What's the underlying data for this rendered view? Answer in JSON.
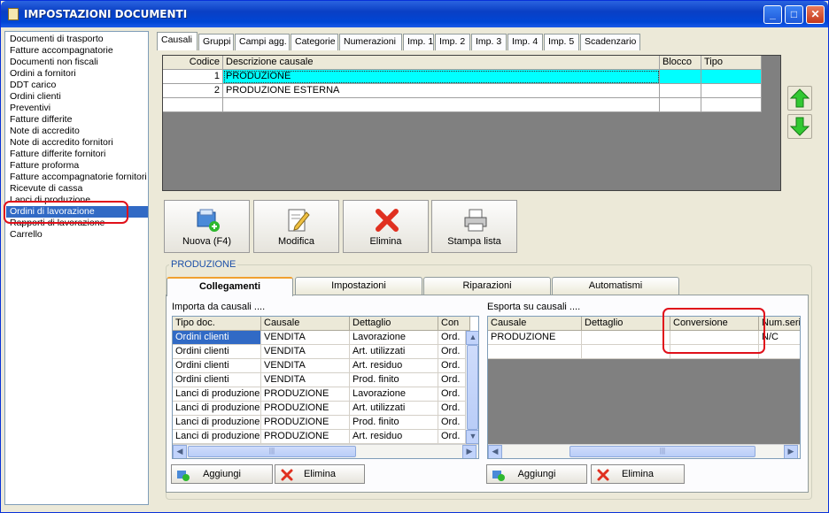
{
  "window": {
    "title": "IMPOSTAZIONI DOCUMENTI"
  },
  "left_list": {
    "items": [
      "Documenti di trasporto",
      "Fatture accompagnatorie",
      "Documenti non fiscali",
      "Ordini a fornitori",
      "DDT carico",
      "Ordini clienti",
      "Preventivi",
      "Fatture differite",
      "Note di accredito",
      "Note di accredito fornitori",
      "Fatture differite fornitori",
      "Fatture proforma",
      "Fatture accompagnatorie fornitori",
      "Ricevute di cassa",
      "Lanci di produzione",
      "Ordini di lavorazione",
      "Rapporti di lavorazione",
      "Carrello"
    ],
    "selected": "Ordini di lavorazione"
  },
  "top_tabs": [
    "Causali",
    "Gruppi",
    "Campi agg.",
    "Categorie",
    "Numerazioni",
    "Imp. 1",
    "Imp. 2",
    "Imp. 3",
    "Imp. 4",
    "Imp. 5",
    "Scadenzario"
  ],
  "causali_grid": {
    "headers": [
      "Codice",
      "Descrizione causale",
      "Blocco",
      "Tipo"
    ],
    "rows": [
      {
        "codice": "1",
        "descrizione": "PRODUZIONE",
        "blocco": "",
        "tipo": ""
      },
      {
        "codice": "2",
        "descrizione": "PRODUZIONE ESTERNA",
        "blocco": "",
        "tipo": ""
      }
    ]
  },
  "toolbar": {
    "nuova": "Nuova (F4)",
    "modifica": "Modifica",
    "elimina": "Elimina",
    "stampa": "Stampa lista"
  },
  "group": {
    "title": "PRODUZIONE"
  },
  "sub_tabs": [
    "Collegamenti",
    "Impostazioni",
    "Riparazioni",
    "Automatismi"
  ],
  "import_pane": {
    "title": "Importa da causali ....",
    "headers": [
      "Tipo doc.",
      "Causale",
      "Dettaglio",
      "Con"
    ],
    "rows": [
      [
        "Ordini clienti",
        "VENDITA",
        "Lavorazione",
        "Ord."
      ],
      [
        "Ordini clienti",
        "VENDITA",
        "Art. utilizzati",
        "Ord."
      ],
      [
        "Ordini clienti",
        "VENDITA",
        "Art. residuo",
        "Ord."
      ],
      [
        "Ordini clienti",
        "VENDITA",
        "Prod. finito",
        "Ord."
      ],
      [
        "Lanci di produzione",
        "PRODUZIONE",
        "Lavorazione",
        "Ord."
      ],
      [
        "Lanci di produzione",
        "PRODUZIONE",
        "Art. utilizzati",
        "Ord."
      ],
      [
        "Lanci di produzione",
        "PRODUZIONE",
        "Prod. finito",
        "Ord."
      ],
      [
        "Lanci di produzione",
        "PRODUZIONE",
        "Art. residuo",
        "Ord."
      ]
    ],
    "add": "Aggiungi",
    "delete": "Elimina"
  },
  "export_pane": {
    "title": "Esporta su causali ....",
    "headers": [
      "Causale",
      "Dettaglio",
      "Conversione",
      "Num.seri"
    ],
    "rows": [
      [
        "PRODUZIONE",
        "",
        "",
        "N/C"
      ]
    ],
    "add": "Aggiungi",
    "delete": "Elimina"
  },
  "colors": {
    "accent": "#316ac5",
    "highlight": "#00ffff",
    "annotation": "#e0101a"
  }
}
